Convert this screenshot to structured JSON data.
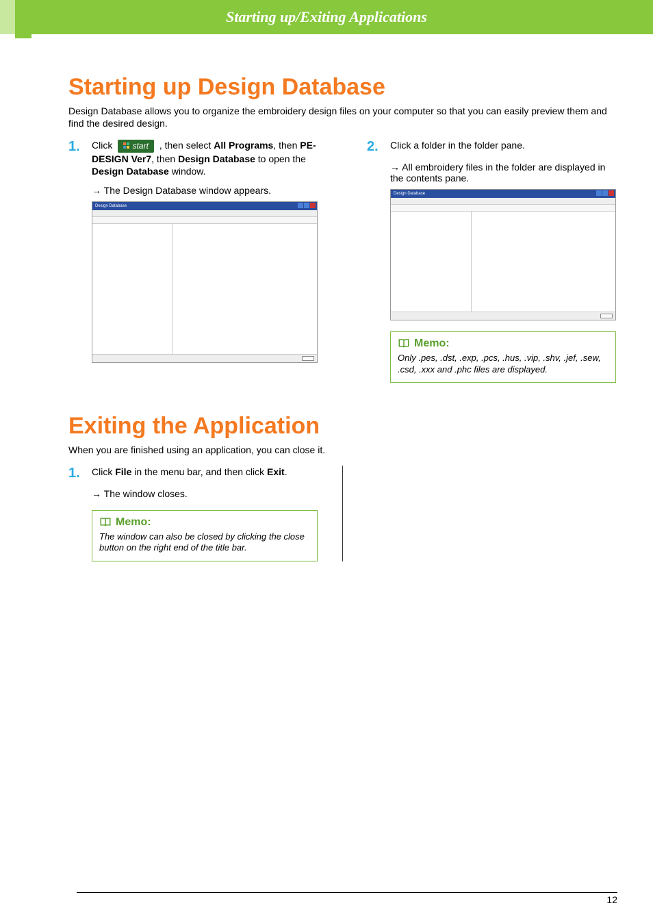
{
  "header": {
    "title": "Starting up/Exiting Applications"
  },
  "section1": {
    "heading": "Starting up Design Database",
    "intro": "Design Database allows you to organize the embroidery design files on your computer so that you can easily preview them and find the desired design.",
    "step1": {
      "num": "1.",
      "pre": "Click ",
      "btn": "start",
      "post1": " , then select ",
      "b1": "All Programs",
      "post2": ", then ",
      "b2": "PE-DESIGN Ver7",
      "post3": ", then ",
      "b3": "Design Database",
      "post4": " to open the ",
      "b4": "Design Database",
      "post5": " window."
    },
    "arrow1": "The Design Database window appears.",
    "step2": {
      "num": "2.",
      "text": "Click a folder in the folder pane."
    },
    "arrow2": "All embroidery files in the folder are displayed in the contents pane.",
    "memo": {
      "title": "Memo:",
      "text": "Only .pes, .dst, .exp, .pcs, .hus, .vip, .shv, .jef, .sew, .csd, .xxx and .phc files are displayed."
    },
    "screenshot1_title": "Design Database",
    "screenshot2_title": "Design Database"
  },
  "section2": {
    "heading": "Exiting the Application",
    "intro": "When you are finished using an application, you can close it.",
    "step1": {
      "num": "1.",
      "pre": "Click ",
      "b1": "File",
      "mid": " in the menu bar, and then click ",
      "b2": "Exit",
      "post": "."
    },
    "arrow1": "The window closes.",
    "memo": {
      "title": "Memo:",
      "text": "The window can also be closed by clicking the close button on the right end of the title bar."
    }
  },
  "pageNumber": "12"
}
